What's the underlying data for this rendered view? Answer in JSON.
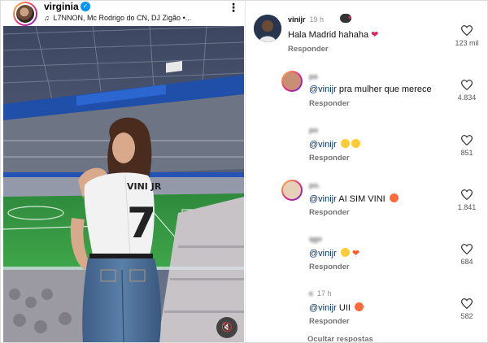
{
  "post": {
    "username": "virginia",
    "song": "L7NNON, Mc Rodrigo do CN, DJ Zigão •..."
  },
  "comments": [
    {
      "user": "vinijr",
      "time": "19 h",
      "text": "Hala Madrid hahaha",
      "reply_label": "Responder",
      "likes": "123 mil"
    },
    {
      "user": "pa",
      "time": "",
      "mention": "@vinijr",
      "text": "pra mulher que merece",
      "reply_label": "Responder",
      "likes": "4.834"
    },
    {
      "user": "po",
      "time": "",
      "mention": "@vinijr",
      "text": "",
      "reply_label": "Responder",
      "likes": "851"
    },
    {
      "user": "po.",
      "time": "",
      "mention": "@vinijr",
      "text": "AI SIM VINI",
      "reply_label": "Responder",
      "likes": "1.841"
    },
    {
      "user": "qgv",
      "time": "",
      "mention": "@vinijr",
      "text": "",
      "reply_label": "Responder",
      "likes": "684"
    },
    {
      "user": "e",
      "time": "17 h",
      "mention": "@vinijr",
      "text": "UII",
      "reply_label": "Responder",
      "likes": "582"
    }
  ],
  "hide_replies": "Ocultar respostas",
  "colors": {
    "verified": "#0095f6",
    "mention": "#00376b",
    "secondary_text": "#737373"
  }
}
